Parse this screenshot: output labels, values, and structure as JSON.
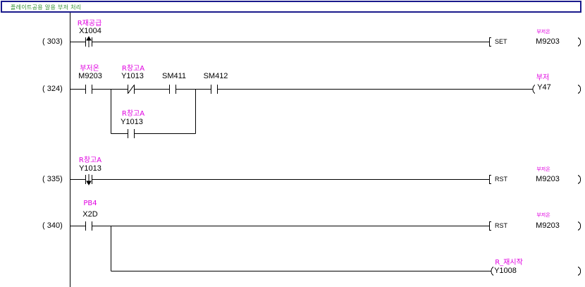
{
  "header": {
    "title": "플레이트공용 알용 부저 처리"
  },
  "rungs": [
    {
      "step_label": "(   303)",
      "contact": {
        "comment": "R재공급",
        "device": "X1004"
      },
      "instruction": "SET",
      "output": {
        "comment": "부저온",
        "device": "M9203"
      }
    },
    {
      "step_label": "(   324)",
      "contacts": [
        {
          "comment": "부저온",
          "device": "M9203"
        },
        {
          "comment": "R창고A",
          "device": "Y1013"
        },
        {
          "comment": "",
          "device": "SM411"
        },
        {
          "comment": "",
          "device": "SM412"
        }
      ],
      "branch_contact": {
        "comment": "R창고A",
        "device": "Y1013"
      },
      "output": {
        "comment": "부저",
        "device": "Y47"
      }
    },
    {
      "step_label": "(   335)",
      "contact": {
        "comment": "R창고A",
        "device": "Y1013"
      },
      "instruction": "RST",
      "output": {
        "comment": "부저온",
        "device": "M9203"
      }
    },
    {
      "step_label": "(   340)",
      "contact": {
        "comment": "PB4",
        "device": "X2D"
      },
      "instruction": "RST",
      "output": {
        "comment": "부저온",
        "device": "M9203"
      },
      "branch_output": {
        "comment": "R_재시작",
        "device": "Y1008"
      }
    }
  ]
}
